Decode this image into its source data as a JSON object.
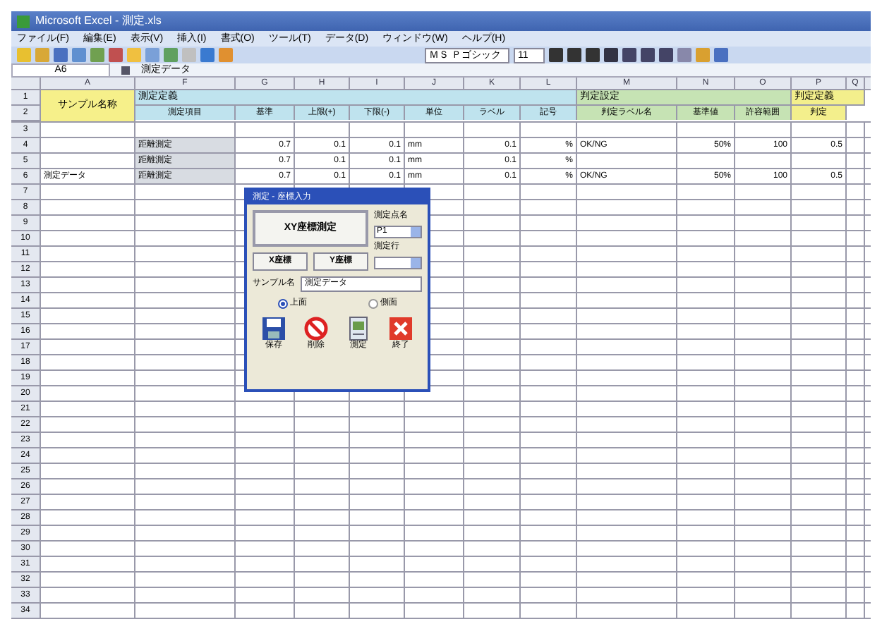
{
  "window": {
    "title": "Microsoft Excel - 測定.xls"
  },
  "menu": [
    "ファイル(F)",
    "編集(E)",
    "表示(V)",
    "挿入(I)",
    "書式(O)",
    "ツール(T)",
    "データ(D)",
    "ウィンドウ(W)",
    "ヘルプ(H)"
  ],
  "font_box": {
    "font": "ＭＳ Ｐゴシック",
    "size": "11"
  },
  "formula_bar": {
    "name_box": "A6",
    "value": "測定データ"
  },
  "sheet": {
    "columns": [
      "A",
      "F",
      "G",
      "H",
      "I",
      "J",
      "K",
      "L",
      "M",
      "N",
      "O",
      "P",
      "Q"
    ],
    "name_header": "サンプル名称",
    "header_rows": [
      "1",
      "2"
    ],
    "groups": [
      {
        "label": "測定定義",
        "color": "#bfe3ee"
      },
      {
        "label": "判定設定",
        "color": "#c6e3b4"
      },
      {
        "label": "判定定義",
        "color": "#f3ef8c"
      }
    ],
    "subheaders": [
      "測定項目",
      "基準",
      "上限(+)",
      "下限(-)",
      "単位",
      "ラベル",
      "記号",
      "判定ラベル名",
      "基準値",
      "許容範囲",
      "判定"
    ],
    "rows": [
      {
        "number": "3",
        "cells": {}
      },
      {
        "number": "4",
        "cells": {
          "F": "距離測定",
          "G": "0.7",
          "H": "0.1",
          "I": "0.1",
          "J": "mm",
          "K": "0.1",
          "L": "%",
          "M": "OK/NG",
          "N": "50%",
          "O": "100",
          "P": "0.5"
        }
      },
      {
        "number": "5",
        "cells": {
          "F": "距離測定",
          "G": "0.7",
          "H": "0.1",
          "I": "0.1",
          "J": "mm",
          "K": "0.1",
          "L": "%"
        }
      },
      {
        "number": "6",
        "cells": {
          "A": "測定データ",
          "F": "距離測定",
          "G": "0.7",
          "H": "0.1",
          "I": "0.1",
          "J": "mm",
          "K": "0.1",
          "L": "%",
          "M": "OK/NG",
          "N": "50%",
          "O": "100",
          "P": "0.5"
        }
      },
      {
        "number": "7",
        "cells": {}
      },
      {
        "number": "8",
        "cells": {}
      },
      {
        "number": "9",
        "cells": {}
      },
      {
        "number": "10",
        "cells": {}
      },
      {
        "number": "11",
        "cells": {}
      },
      {
        "number": "12",
        "cells": {}
      },
      {
        "number": "13",
        "cells": {}
      },
      {
        "number": "14",
        "cells": {}
      },
      {
        "number": "15",
        "cells": {}
      },
      {
        "number": "16",
        "cells": {}
      },
      {
        "number": "17",
        "cells": {}
      },
      {
        "number": "18",
        "cells": {}
      },
      {
        "number": "19",
        "cells": {}
      },
      {
        "number": "20",
        "cells": {}
      },
      {
        "number": "21",
        "cells": {}
      },
      {
        "number": "22",
        "cells": {}
      },
      {
        "number": "23",
        "cells": {}
      },
      {
        "number": "24",
        "cells": {}
      },
      {
        "number": "25",
        "cells": {}
      },
      {
        "number": "26",
        "cells": {}
      },
      {
        "number": "27",
        "cells": {}
      },
      {
        "number": "28",
        "cells": {}
      },
      {
        "number": "29",
        "cells": {}
      },
      {
        "number": "30",
        "cells": {}
      },
      {
        "number": "31",
        "cells": {}
      },
      {
        "number": "32",
        "cells": {}
      },
      {
        "number": "33",
        "cells": {}
      },
      {
        "number": "34",
        "cells": {}
      }
    ]
  },
  "dialog": {
    "title": "測定 - 座標入力",
    "main_button": "XY座標測定",
    "small_buttons": [
      "X座標",
      "Y座標"
    ],
    "point_label": "測定点名",
    "point_value": "P1",
    "row_label": "測定行",
    "sample_label": "サンプル名",
    "sample_value": "測定データ",
    "radios": [
      {
        "label": "上面",
        "selected": true
      },
      {
        "label": "側面",
        "selected": false
      }
    ],
    "actions": [
      {
        "kind": "save",
        "label": "保存"
      },
      {
        "kind": "delete",
        "label": "削除"
      },
      {
        "kind": "measure",
        "label": "測定"
      },
      {
        "kind": "exit",
        "label": "終了"
      }
    ]
  }
}
